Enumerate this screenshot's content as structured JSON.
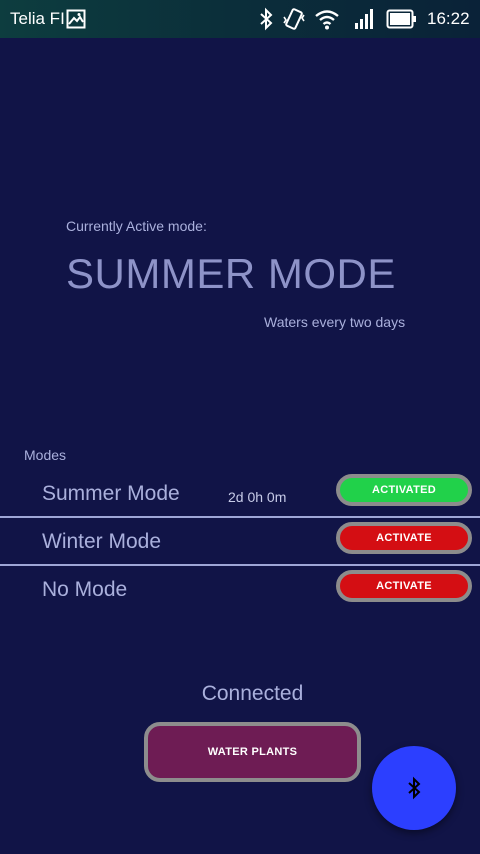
{
  "status_bar": {
    "carrier": "Telia FI",
    "time": "16:22",
    "icons": [
      "gallery-icon",
      "bluetooth-icon",
      "vibrate-icon",
      "wifi-icon",
      "signal-icon",
      "battery-icon"
    ]
  },
  "active": {
    "label": "Currently Active mode:",
    "mode": "SUMMER MODE",
    "description": "Waters every two days"
  },
  "modes": {
    "header": "Modes",
    "items": [
      {
        "name": "Summer Mode",
        "timer": "2d 0h 0m",
        "button": "ACTIVATED",
        "state": "active"
      },
      {
        "name": "Winter Mode",
        "timer": "",
        "button": "ACTIVATE",
        "state": "inactive"
      },
      {
        "name": "No Mode",
        "timer": "",
        "button": "ACTIVATE",
        "state": "inactive"
      }
    ]
  },
  "connection": {
    "status": "Connected"
  },
  "actions": {
    "water_plants": "WATER PLANTS",
    "fab_icon": "bluetooth-icon"
  },
  "colors": {
    "background": "#111447",
    "activated": "#21d14a",
    "activate": "#d40e13",
    "water_button": "#6e1c54",
    "fab": "#2c3fff"
  }
}
